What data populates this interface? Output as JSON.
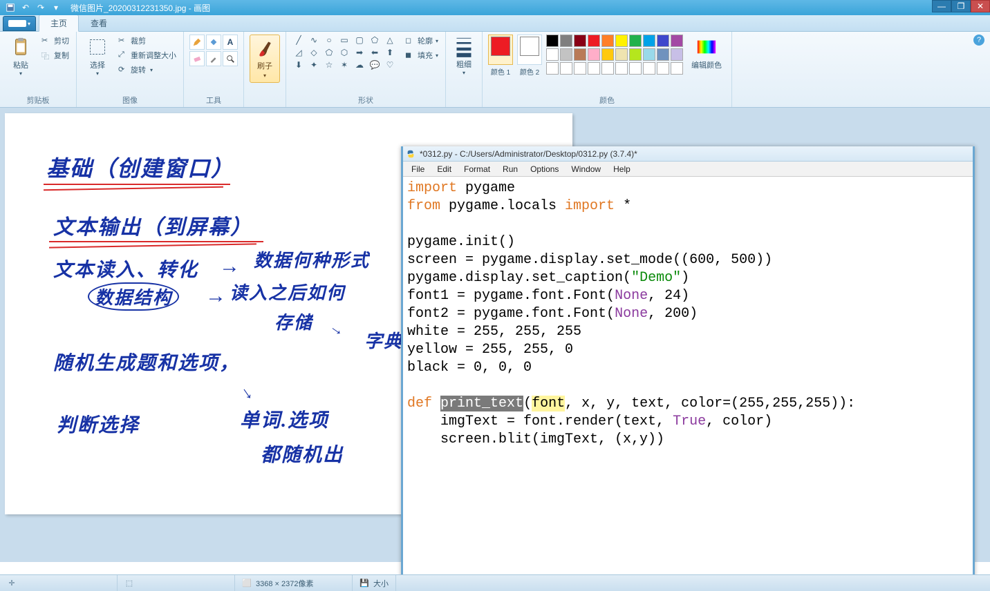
{
  "window": {
    "title_prefix": "微信图片_20200312231350.jpg",
    "title_app": "画图"
  },
  "tabs": {
    "home": "主页",
    "view": "查看"
  },
  "ribbon": {
    "clipboard": {
      "label": "剪贴板",
      "paste": "粘贴",
      "cut": "剪切",
      "copy": "复制"
    },
    "image": {
      "label": "图像",
      "select": "选择",
      "crop": "裁剪",
      "resize": "重新调整大小",
      "rotate": "旋转"
    },
    "tools": {
      "label": "工具"
    },
    "brush": {
      "label": "刷子"
    },
    "shapes": {
      "label": "形状",
      "outline": "轮廓",
      "fill": "填充"
    },
    "thickness": {
      "label": "粗细"
    },
    "colors": {
      "label": "颜色",
      "color1": "颜色 1",
      "color2": "颜色 2",
      "edit": "编辑颜色"
    }
  },
  "status": {
    "dimensions": "3368 × 2372像素",
    "size_label": "大小"
  },
  "idle": {
    "title": "*0312.py - C:/Users/Administrator/Desktop/0312.py (3.7.4)*",
    "menu": [
      "File",
      "Edit",
      "Format",
      "Run",
      "Options",
      "Window",
      "Help"
    ],
    "code": {
      "l1_import": "import",
      "l1_rest": " pygame",
      "l2_from": "from",
      "l2_mid": " pygame.locals ",
      "l2_import": "import",
      "l2_star": " *",
      "l3": "",
      "l4": "pygame.init()",
      "l5": "screen = pygame.display.set_mode((600, 500))",
      "l6_pre": "pygame.display.set_caption(",
      "l6_str": "\"Demo\"",
      "l6_post": ")",
      "l7_pre": "font1 = pygame.font.Font(",
      "l7_none": "None",
      "l7_post": ", 24)",
      "l8_pre": "font2 = pygame.font.Font(",
      "l8_none": "None",
      "l8_post": ", 200)",
      "l9": "white = 255, 255, 255",
      "l10": "yellow = 255, 255, 0",
      "l11": "black = 0, 0, 0",
      "l12": "",
      "l13_def": "def",
      "l13_sp": " ",
      "l13_name": "print_text",
      "l13_paren": "(",
      "l13_font": "font",
      "l13_rest": ", x, y, text, color=(255,255,255)):",
      "l14_pre": "    imgText = font.render(text, ",
      "l14_true": "True",
      "l14_post": ", color)",
      "l15": "    screen.blit(imgText, (x,y))"
    }
  },
  "handwriting": {
    "line1": "基础（创建窗口）",
    "line2": "文本输出（到屏幕）",
    "line3": "文本读入、转化",
    "line3b": "数据结构",
    "line3r1": "数据何种形式",
    "line3r2": "读入之后如何",
    "line3r3": "存储",
    "line3r4": "字典",
    "line4": "随机生成题和选项，",
    "line5": "判断选择",
    "line5b": "单词.选项",
    "line5c": "都随机出"
  },
  "palette": {
    "row1": [
      "#000000",
      "#7f7f7f",
      "#880015",
      "#ed1c24",
      "#ff7f27",
      "#fff200",
      "#22b14c",
      "#00a2e8",
      "#3f48cc",
      "#a349a4"
    ],
    "row2": [
      "#ffffff",
      "#c3c3c3",
      "#b97a57",
      "#ffaec9",
      "#ffc90e",
      "#efe4b0",
      "#b5e61d",
      "#99d9ea",
      "#7092be",
      "#c8bfe7"
    ],
    "row3": [
      "#ffffff",
      "#ffffff",
      "#ffffff",
      "#ffffff",
      "#ffffff",
      "#ffffff",
      "#ffffff",
      "#ffffff",
      "#ffffff",
      "#ffffff"
    ]
  },
  "color1_value": "#ed1c24",
  "color2_value": "#ffffff"
}
